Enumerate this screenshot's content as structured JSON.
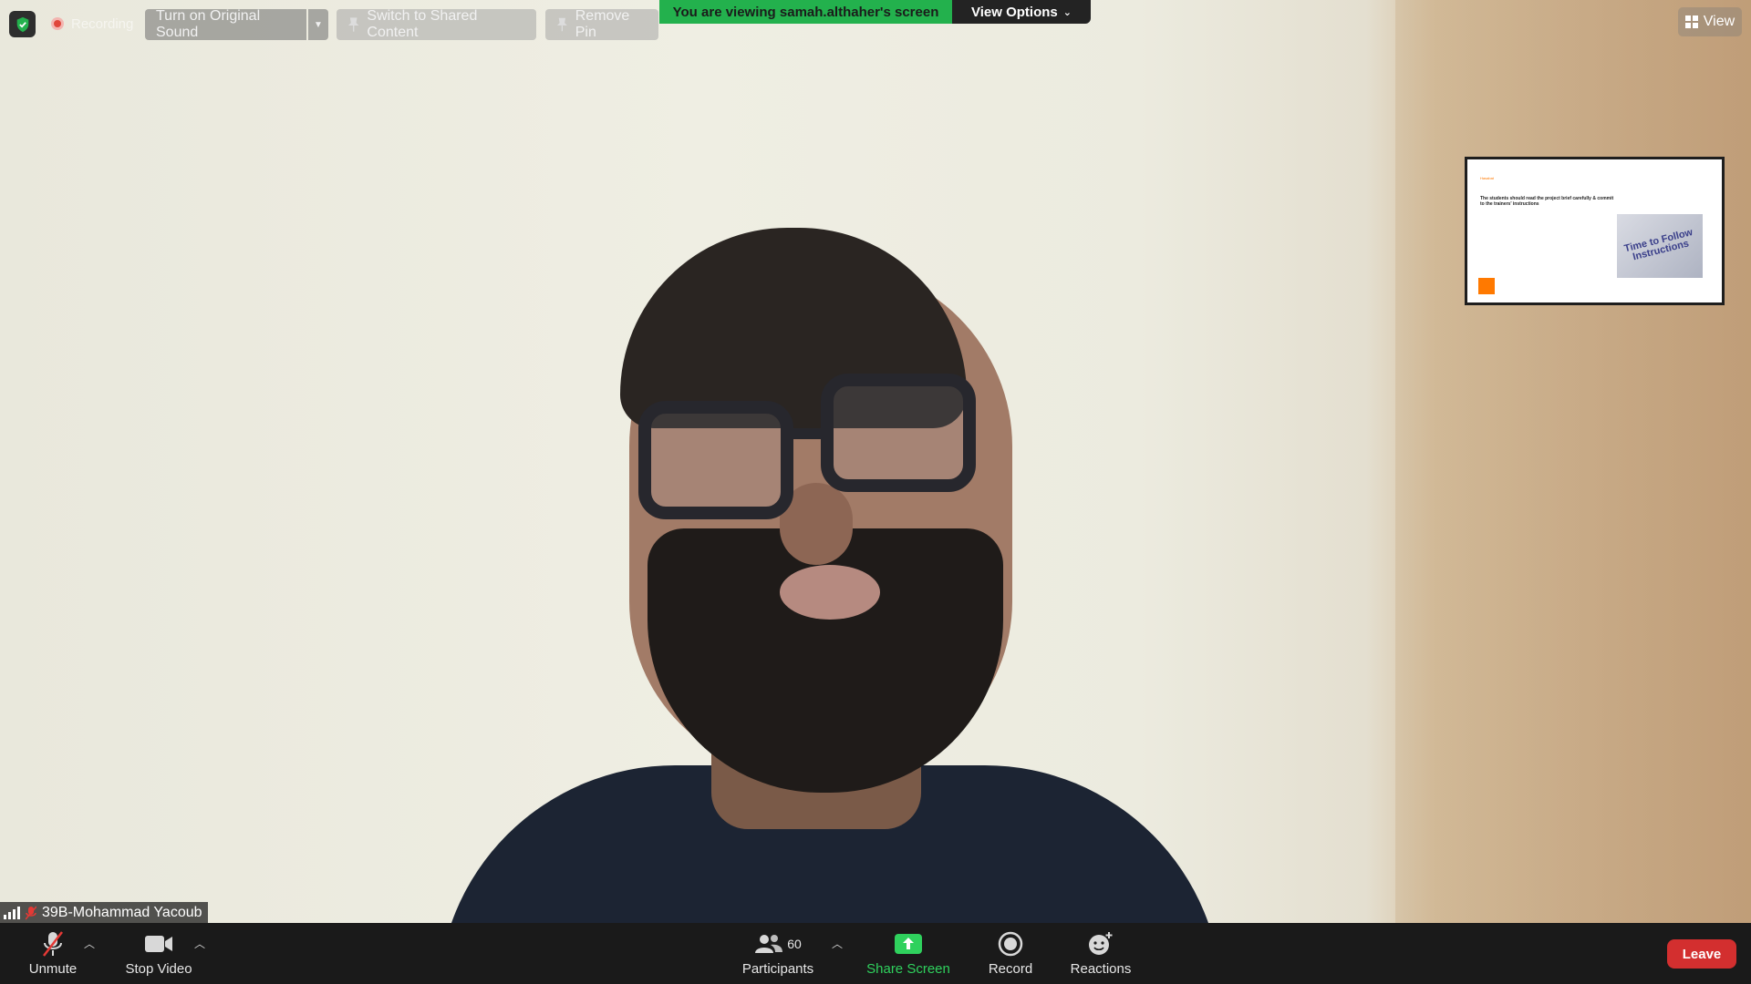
{
  "top_bar": {
    "recording_label": "Recording",
    "original_sound_label": "Turn on Original Sound",
    "switch_shared_label": "Switch to Shared Content",
    "remove_pin_label": "Remove Pin",
    "viewing_banner": "You are viewing samah.althaher's screen",
    "view_options_label": "View Options",
    "view_label": "View"
  },
  "shared_thumbnail": {
    "small_title": "Hasabat",
    "slide_text": "The students should read the project brief carefully & commit to the trainers' instructions",
    "image_caption": "Time to Follow Instructions"
  },
  "participant": {
    "name": "39B-Mohammad Yacoub"
  },
  "toolbar": {
    "unmute_label": "Unmute",
    "stop_video_label": "Stop Video",
    "participants_label": "Participants",
    "participants_count": "60",
    "share_screen_label": "Share Screen",
    "record_label": "Record",
    "reactions_label": "Reactions",
    "leave_label": "Leave"
  },
  "colors": {
    "viewing_banner": "#23b14d",
    "share_screen": "#2fd15d",
    "leave": "#d32f2f",
    "toolbar_bg": "#1a1a1a"
  },
  "icons": [
    "shield-check-icon",
    "record-dot-icon",
    "pin-icon",
    "chevron-down-icon",
    "grid-view-icon",
    "signal-icon",
    "mic-muted-icon",
    "video-camera-icon",
    "participants-icon",
    "share-screen-icon",
    "record-icon",
    "reactions-icon"
  ]
}
